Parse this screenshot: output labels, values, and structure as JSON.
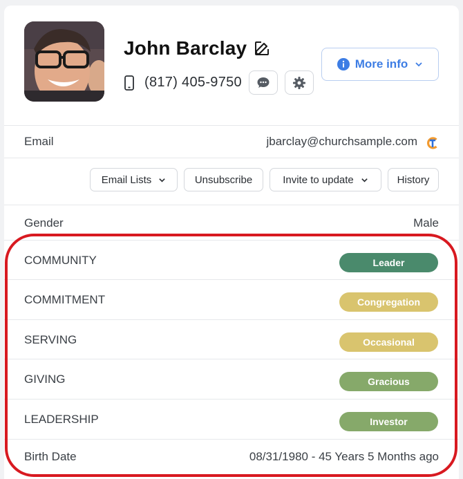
{
  "profile": {
    "name": "John Barclay",
    "phone": "(817) 405-9750",
    "more_info_label": "More info"
  },
  "email": {
    "label": "Email",
    "value": "jbarclay@churchsample.com"
  },
  "actions": {
    "email_lists": "Email Lists",
    "unsubscribe": "Unsubscribe",
    "invite": "Invite to update",
    "history": "History"
  },
  "gender": {
    "label": "Gender",
    "value": "Male"
  },
  "attributes": [
    {
      "label": "COMMUNITY",
      "badge": "Leader",
      "color": "#4a8a6c"
    },
    {
      "label": "COMMITMENT",
      "badge": "Congregation",
      "color": "#d9c46e"
    },
    {
      "label": "SERVING",
      "badge": "Occasional",
      "color": "#d9c46e"
    },
    {
      "label": "GIVING",
      "badge": "Gracious",
      "color": "#86a96a"
    },
    {
      "label": "LEADERSHIP",
      "badge": "Investor",
      "color": "#86a96a"
    }
  ],
  "birth": {
    "label": "Birth Date",
    "value": "08/31/1980 - 45 Years 5 Months ago"
  },
  "icons": [
    "edit-icon",
    "phone-icon",
    "chat-bubble-icon",
    "gear-icon",
    "info-icon",
    "chevron-down-icon",
    "brand-logo-icon"
  ],
  "colors": {
    "accent": "#3d7de4",
    "highlight": "#d81920"
  }
}
